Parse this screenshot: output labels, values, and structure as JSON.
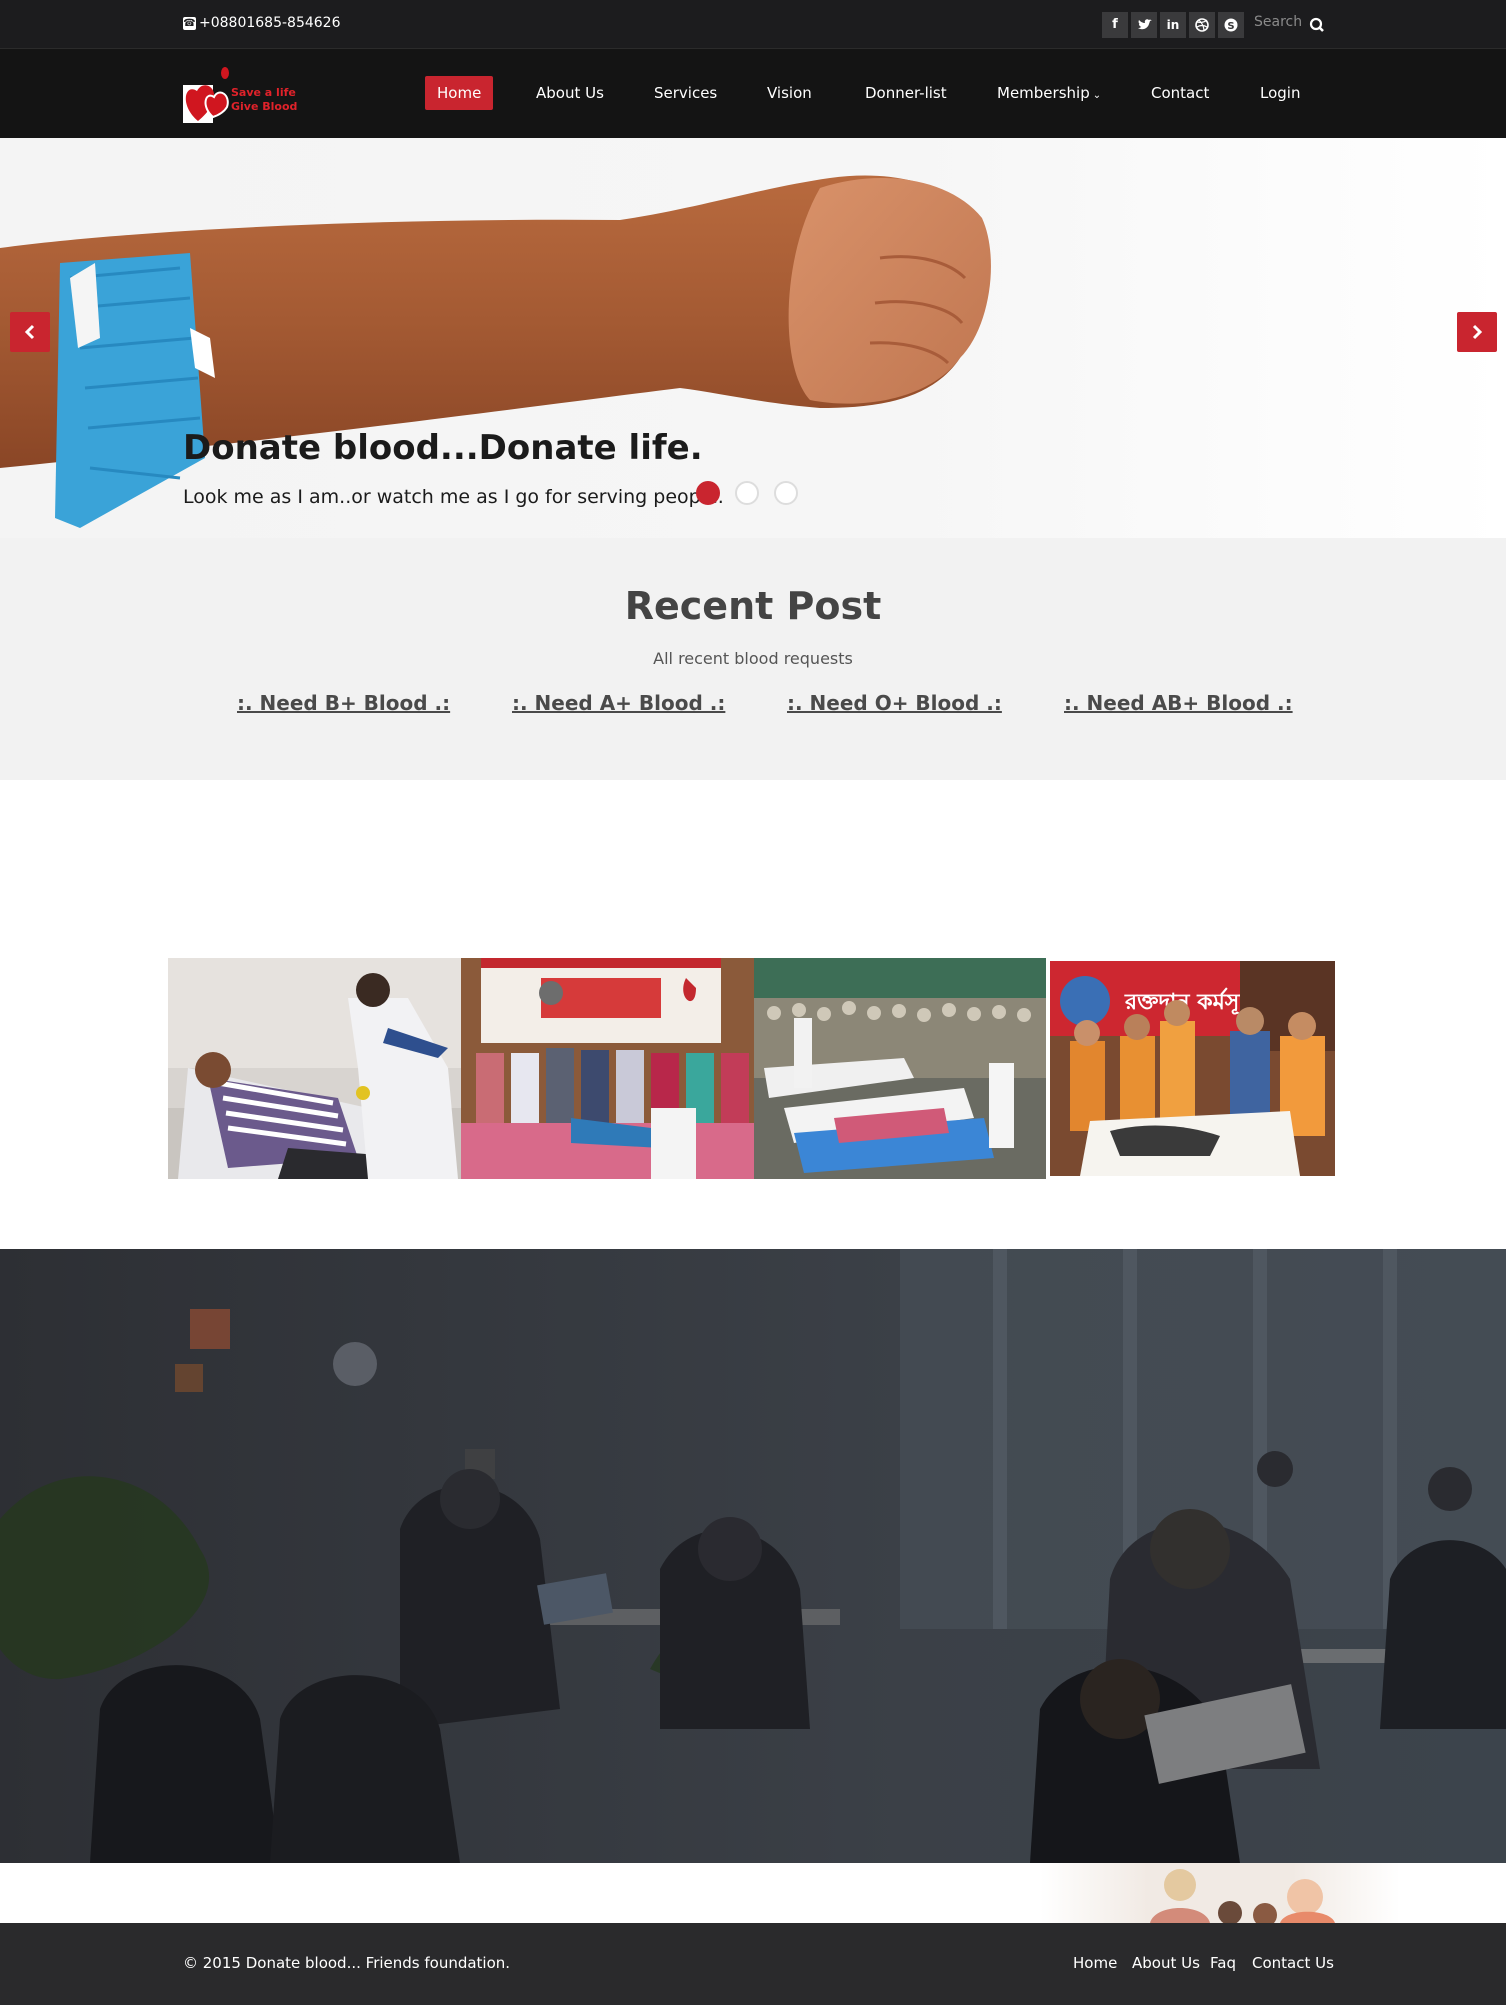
{
  "topbar": {
    "phone": "+08801685-854626",
    "social_icons": [
      "facebook-icon",
      "twitter-icon",
      "linkedin-icon",
      "dribbble-icon",
      "skype-icon"
    ],
    "search_placeholder": "Search"
  },
  "nav": {
    "items": [
      {
        "label": "Home",
        "active": true
      },
      {
        "label": "About Us"
      },
      {
        "label": "Services"
      },
      {
        "label": "Vision"
      },
      {
        "label": "Donner-list"
      },
      {
        "label": "Membership"
      },
      {
        "label": "Contact"
      },
      {
        "label": "Login"
      }
    ]
  },
  "logo": {
    "line1": "Save a life",
    "line2": "Give Blood"
  },
  "hero": {
    "title": "Donate blood...Donate life.",
    "subtitle": "Look me as I am..or watch me as I go for serving people.",
    "slides": 3,
    "active_slide": 1
  },
  "recent": {
    "title": "Recent Post",
    "subtitle": "All recent blood requests",
    "requests": [
      ":. Need B+ Blood .:",
      ":. Need A+ Blood .:",
      ":. Need O+ Blood .:",
      ":. Need AB+ Blood .:"
    ]
  },
  "footer": {
    "copyright": "© 2015 Donate blood... Friends foundation.",
    "links": [
      "Home",
      "About Us",
      "Faq",
      "Contact Us"
    ]
  },
  "colors": {
    "accent": "#c9252f",
    "dark": "#141414"
  }
}
